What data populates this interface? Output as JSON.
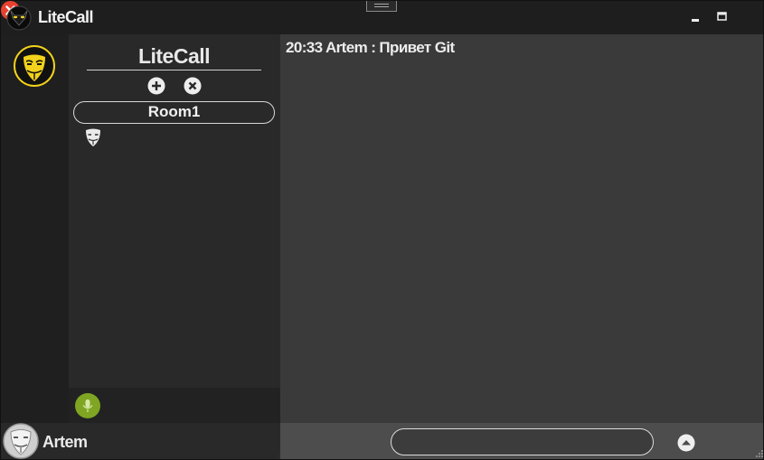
{
  "window": {
    "title": "LiteCall"
  },
  "sidebar": {
    "user": {
      "name": "Artem"
    }
  },
  "servers": {
    "title": "LiteCall",
    "rooms": [
      {
        "label": "Room1"
      }
    ]
  },
  "chat": {
    "messages": [
      {
        "time": "20:33",
        "author": "Artem",
        "separator": ":",
        "text": "Привет Git"
      }
    ]
  },
  "composer": {
    "value": "",
    "placeholder": ""
  },
  "icons": {
    "app": "mask-logo-icon",
    "add": "plus-circle-icon",
    "remove": "x-circle-icon",
    "mic": "microphone-icon",
    "send": "chevron-up-circle-icon",
    "minimize": "minimize-icon",
    "maximize": "maximize-icon",
    "close": "close-icon"
  },
  "colors": {
    "accent_yellow": "#f2d21b",
    "close_red": "#e8412f",
    "mic_green": "#7fa523",
    "background_dark": "#2b2b2b",
    "chat_bg": "#3a3a3a"
  }
}
